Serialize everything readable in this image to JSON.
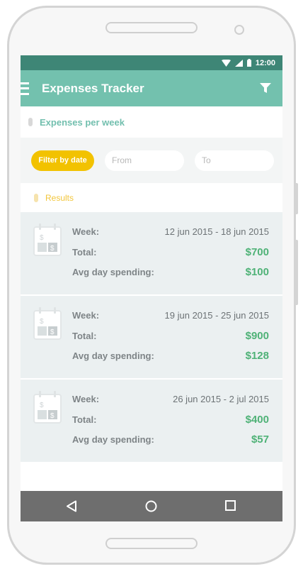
{
  "status": {
    "time": "12:00"
  },
  "app": {
    "title": "Expenses Tracker"
  },
  "section": {
    "title": "Expenses per week"
  },
  "filter": {
    "button_label": "Filter by  date",
    "from_placeholder": "From",
    "to_placeholder": "To"
  },
  "results": {
    "title": "Results",
    "labels": {
      "week": "Week:",
      "total": "Total:",
      "avg": "Avg day spending:"
    },
    "items": [
      {
        "week": "12 jun 2015  -  18 jun 2015",
        "total": "$700",
        "avg": "$100"
      },
      {
        "week": "19 jun 2015  -  25 jun 2015",
        "total": "$900",
        "avg": "$128"
      },
      {
        "week": "26 jun 2015  -  2 jul 2015",
        "total": "$400",
        "avg": "$57"
      }
    ]
  },
  "icons": {
    "menu": "hamburger-icon",
    "filter": "funnel-icon",
    "calendar": "calendar-dollar-icon",
    "back": "triangle-back-icon",
    "home": "circle-home-icon",
    "recents": "square-recents-icon",
    "wifi": "wifi-icon",
    "signal": "signal-icon",
    "battery": "battery-icon"
  },
  "colors": {
    "status_bar": "#3e8676",
    "app_bar": "#73c1ae",
    "accent_yellow": "#f2c200",
    "money_green": "#4fb277",
    "card_bg": "#ebf0f1"
  }
}
